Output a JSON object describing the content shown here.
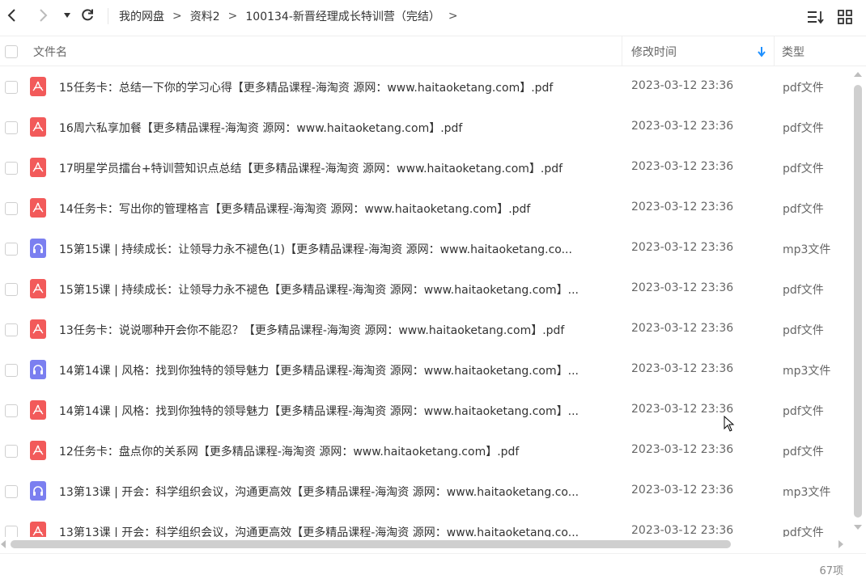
{
  "breadcrumb": [
    "我的网盘",
    "资料2",
    "100134-新晋经理成长特训营（完结）"
  ],
  "breadcrumb_separator": ">",
  "columns": {
    "name": "文件名",
    "time": "修改时间",
    "type": "类型"
  },
  "files": [
    {
      "name": "15任务卡：总结一下你的学习心得【更多精品课程-海淘资 源网：www.haitaoketang.com】.pdf",
      "time": "2023-03-12 23:36",
      "type": "pdf文件",
      "icon": "pdf"
    },
    {
      "name": "16周六私享加餐【更多精品课程-海淘资 源网：www.haitaoketang.com】.pdf",
      "time": "2023-03-12 23:36",
      "type": "pdf文件",
      "icon": "pdf"
    },
    {
      "name": "17明星学员擂台+特训营知识点总结【更多精品课程-海淘资 源网：www.haitaoketang.com】.pdf",
      "time": "2023-03-12 23:36",
      "type": "pdf文件",
      "icon": "pdf"
    },
    {
      "name": "14任务卡：写出你的管理格言【更多精品课程-海淘资 源网：www.haitaoketang.com】.pdf",
      "time": "2023-03-12 23:36",
      "type": "pdf文件",
      "icon": "pdf"
    },
    {
      "name": "15第15课 | 持续成长：让领导力永不褪色(1)【更多精品课程-海淘资 源网：www.haitaoketang.co...",
      "time": "2023-03-12 23:36",
      "type": "mp3文件",
      "icon": "mp3"
    },
    {
      "name": "15第15课 | 持续成长：让领导力永不褪色【更多精品课程-海淘资 源网：www.haitaoketang.com】...",
      "time": "2023-03-12 23:36",
      "type": "pdf文件",
      "icon": "pdf"
    },
    {
      "name": "13任务卡：说说哪种开会你不能忍？【更多精品课程-海淘资 源网：www.haitaoketang.com】.pdf",
      "time": "2023-03-12 23:36",
      "type": "pdf文件",
      "icon": "pdf"
    },
    {
      "name": "14第14课 | 风格：找到你独特的领导魅力【更多精品课程-海淘资 源网：www.haitaoketang.com】...",
      "time": "2023-03-12 23:36",
      "type": "mp3文件",
      "icon": "mp3"
    },
    {
      "name": "14第14课 | 风格：找到你独特的领导魅力【更多精品课程-海淘资 源网：www.haitaoketang.com】...",
      "time": "2023-03-12 23:36",
      "type": "pdf文件",
      "icon": "pdf"
    },
    {
      "name": "12任务卡：盘点你的关系网【更多精品课程-海淘资 源网：www.haitaoketang.com】.pdf",
      "time": "2023-03-12 23:36",
      "type": "pdf文件",
      "icon": "pdf"
    },
    {
      "name": "13第13课 | 开会：科学组织会议，沟通更高效【更多精品课程-海淘资 源网：www.haitaoketang.co...",
      "time": "2023-03-12 23:36",
      "type": "mp3文件",
      "icon": "mp3"
    },
    {
      "name": "13第13课 | 开会：科学组织会议，沟通更高效【更多精品课程-海淘资 源网：www.haitaoketang.co...",
      "time": "2023-03-12 23:36",
      "type": "pdf文件",
      "icon": "pdf"
    }
  ],
  "item_count": "67项",
  "colors": {
    "pdf": "#f25a5a",
    "mp3": "#7b7ff0",
    "sort_arrow": "#1e90ff"
  }
}
